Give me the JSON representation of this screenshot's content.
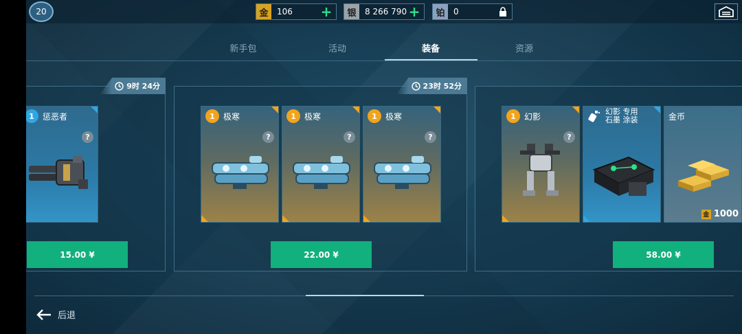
{
  "player": {
    "level": "20"
  },
  "currencies": [
    {
      "badge": "金",
      "amount": "106",
      "action": "+",
      "color": "#d9a21e"
    },
    {
      "badge": "银",
      "amount": "8 266 790",
      "action": "+",
      "color": "#9aa3a8"
    },
    {
      "badge": "铂",
      "amount": "0",
      "color": "#8aa2c0"
    }
  ],
  "tabs": [
    {
      "label": "新手包"
    },
    {
      "label": "活动"
    },
    {
      "label": "装备",
      "active": true
    },
    {
      "label": "资源"
    }
  ],
  "offers": [
    {
      "timer": "9时 24分",
      "price": "15.00 ¥",
      "items": [
        {
          "count": "1",
          "name": "惩恶者",
          "help": "?",
          "icon": "gatling-gun-icon"
        }
      ]
    },
    {
      "timer": "23时 52分",
      "price": "22.00 ¥",
      "items": [
        {
          "count": "1",
          "name": "极寒",
          "help": "?",
          "icon": "frost-cannon-icon"
        },
        {
          "count": "1",
          "name": "极寒",
          "help": "?",
          "icon": "frost-cannon-icon"
        },
        {
          "count": "1",
          "name": "极寒",
          "help": "?",
          "icon": "frost-cannon-icon"
        }
      ]
    },
    {
      "price": "58.00 ¥",
      "items": [
        {
          "count": "1",
          "name": "幻影",
          "help": "?",
          "icon": "phantom-robot-icon"
        },
        {
          "name_line1": "幻影 专用",
          "name_line2": "石墨 涂装",
          "icon": "paint-skin-icon"
        },
        {
          "name": "金币",
          "amount_badge": "金",
          "amount": "1000",
          "icon": "gold-bars-icon"
        }
      ]
    }
  ],
  "footer": {
    "back_label": "后退"
  }
}
